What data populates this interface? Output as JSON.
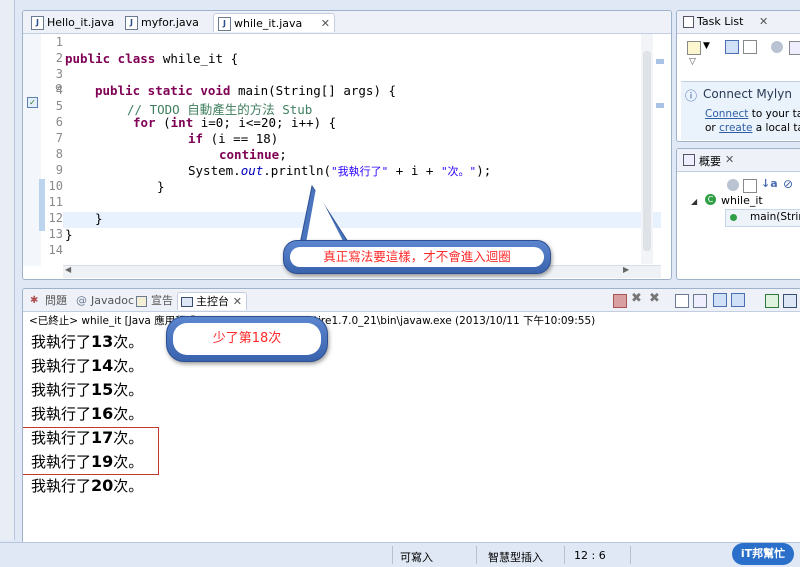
{
  "editor": {
    "tabs": [
      {
        "label": "Hello_it.java"
      },
      {
        "label": "myfor.java"
      },
      {
        "label": "while_it.java",
        "close": "✕"
      }
    ],
    "line_numbers": [
      "1",
      "2",
      "3",
      "4",
      "5",
      "6",
      "7",
      "8",
      "9",
      "10",
      "11",
      "12",
      "13",
      "14"
    ],
    "code": {
      "l2_kw": "public class",
      "l2_rest": " while_it {",
      "l4_kw": "public static void",
      "l4_rest": " main(String[] args) {",
      "l5_comment": "// TODO 自動產生的方法 Stub",
      "l6_kw1": "for",
      "l6_p1": " (",
      "l6_kw2": "int",
      "l6_rest": " i=0; i<=20; i++) {",
      "l7_kw": "if",
      "l7_rest": " (i == 18)",
      "l8_kw": "continue",
      "l8_rest": ";",
      "l9_a": "System.",
      "l9_field": "out",
      "l9_b": ".println(",
      "l9_s1": "\"我執行了\"",
      "l9_c": " + i + ",
      "l9_s2": "\"次。\"",
      "l9_d": ");",
      "l10": "}",
      "l12": "}",
      "l13": "}"
    }
  },
  "callouts": {
    "editor_note": "真正寫法要這樣，才不會進入迴圈",
    "console_note": "少了第18次"
  },
  "console": {
    "tabs": [
      {
        "label": "問題"
      },
      {
        "label": "Javadoc"
      },
      {
        "label": "宣告"
      },
      {
        "label": "主控台",
        "close": "✕"
      }
    ],
    "header": "<已終止> while_it [Java 應用程式] C:\\Program Files\\Java\\jre1.7.0_21\\bin\\javaw.exe (2013/10/11 下午10:09:55)",
    "lines": [
      {
        "pre": "我執行了",
        "num": "13",
        "post": "次。"
      },
      {
        "pre": "我執行了",
        "num": "14",
        "post": "次。"
      },
      {
        "pre": "我執行了",
        "num": "15",
        "post": "次。"
      },
      {
        "pre": "我執行了",
        "num": "16",
        "post": "次。"
      },
      {
        "pre": "我執行了",
        "num": "17",
        "post": "次。"
      },
      {
        "pre": "我執行了",
        "num": "19",
        "post": "次。"
      },
      {
        "pre": "我執行了",
        "num": "20",
        "post": "次。"
      }
    ]
  },
  "task_list": {
    "title": "Task List",
    "close": "✕",
    "mylyn_title": "Connect Mylyn",
    "connect_link": "Connect",
    "connect_rest": " to your task",
    "or_text": "or ",
    "create_link": "create",
    "create_rest": " a local task"
  },
  "outline": {
    "title": "概要",
    "close": "✕",
    "class_name": "while_it",
    "method_name": "main(String"
  },
  "status_bar": {
    "writable": "可寫入",
    "insert_mode": "智慧型插入",
    "position": "12 : 6"
  },
  "watermark": "iT邦幫忙",
  "colors": {
    "accent": "#3a63ad",
    "callout_text": "#ff2a2a",
    "highlight_box": "#c0392b"
  }
}
